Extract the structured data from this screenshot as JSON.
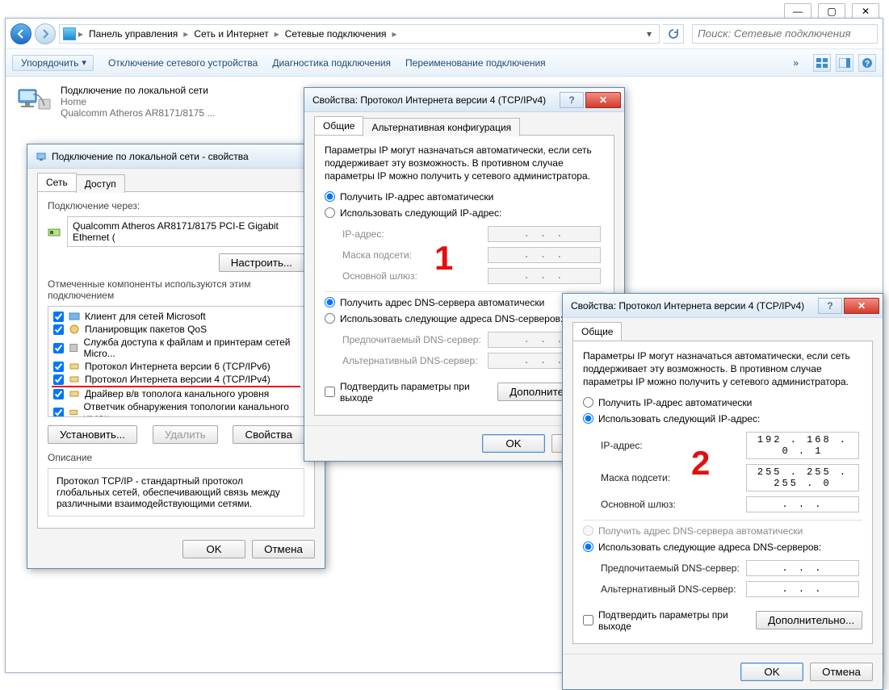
{
  "sys": {
    "min": "—",
    "max": "▢",
    "close": "✕"
  },
  "nav": {
    "breadcrumb": [
      "Панель управления",
      "Сеть и Интернет",
      "Сетевые подключения"
    ],
    "search_placeholder": "Поиск: Сетевые подключения"
  },
  "toolbar": {
    "organize": "Упорядочить",
    "disable": "Отключение сетевого устройства",
    "diagnose": "Диагностика подключения",
    "rename": "Переименование подключения"
  },
  "network_item": {
    "name": "Подключение по локальной сети",
    "status": "Home",
    "device": "Qualcomm Atheros AR8171/8175 ..."
  },
  "props_dlg": {
    "title": "Подключение по локальной сети - свойства",
    "tab_net": "Сеть",
    "tab_access": "Доступ",
    "connect_via_label": "Подключение через:",
    "adapter": "Qualcomm Atheros AR8171/8175 PCI-E Gigabit Ethernet (",
    "configure_btn": "Настроить...",
    "components_label": "Отмеченные компоненты используются этим подключением",
    "items": [
      "Клиент для сетей Microsoft",
      "Планировщик пакетов QoS",
      "Служба доступа к файлам и принтерам сетей Micro...",
      "Протокол Интернета версии 6 (TCP/IPv6)",
      "Протокол Интернета версии 4 (TCP/IPv4)",
      "Драйвер в/в тополога канального уровня",
      "Ответчик обнаружения топологии канального уровн..."
    ],
    "install_btn": "Установить...",
    "uninstall_btn": "Удалить",
    "properties_btn": "Свойства",
    "desc_label": "Описание",
    "desc_text": "Протокол TCP/IP - стандартный протокол глобальных сетей, обеспечивающий связь между различными взаимодействующими сетями.",
    "ok": "OK",
    "cancel": "Отмена"
  },
  "ipv4_dlg": {
    "title": "Свойства: Протокол Интернета версии 4 (TCP/IPv4)",
    "tab_general": "Общие",
    "tab_alt": "Альтернативная конфигурация",
    "intro": "Параметры IP могут назначаться автоматически, если сеть поддерживает эту возможность. В противном случае параметры IP можно получить у сетевого администратора.",
    "radio_auto_ip": "Получить IP-адрес автоматически",
    "radio_manual_ip": "Использовать следующий IP-адрес:",
    "ip_label": "IP-адрес:",
    "mask_label": "Маска подсети:",
    "gateway_label": "Основной шлюз:",
    "radio_auto_dns": "Получить адрес DNS-сервера автоматически",
    "radio_manual_dns": "Использовать следующие адреса DNS-серверов:",
    "dns1_label": "Предпочитаемый DNS-сервер:",
    "dns2_label": "Альтернативный DNS-сервер:",
    "confirm_on_exit": "Подтвердить параметры при выходе",
    "advanced_btn": "Дополнительно...",
    "ok": "OK",
    "cancel": "Отмена",
    "dlg2": {
      "ip": "192 . 168 .  0  .  1",
      "mask": "255 . 255 . 255 .  0",
      "gateway": ".       .       .",
      "dns_empty": ".       .       ."
    }
  },
  "annotations": {
    "one": "1",
    "two": "2"
  }
}
